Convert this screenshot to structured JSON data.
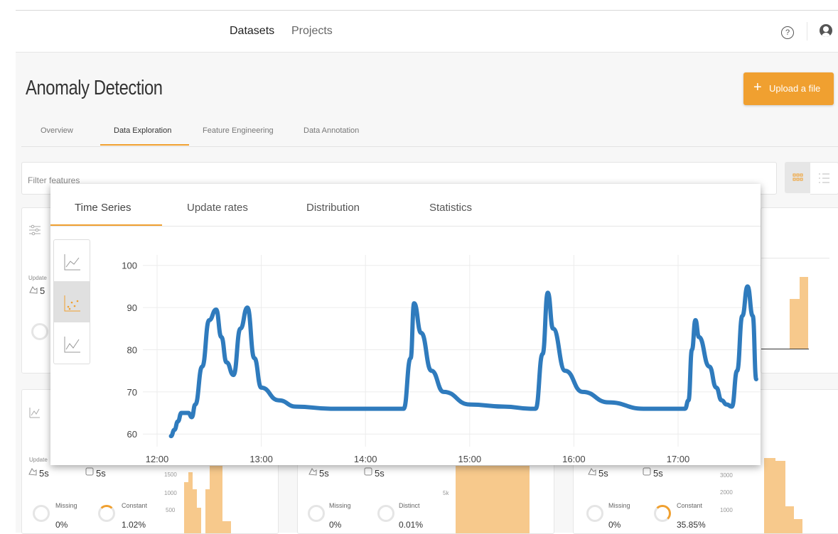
{
  "nav": {
    "datasets": "Datasets",
    "projects": "Projects",
    "help_icon": "?"
  },
  "page": {
    "title": "Anomaly Detection",
    "upload_label": "Upload a file",
    "upload_plus": "+"
  },
  "tabs": [
    "Overview",
    "Data Exploration",
    "Feature Engineering",
    "Data Annotation"
  ],
  "filter": {
    "placeholder": "Filter features"
  },
  "popup": {
    "tabs": [
      "Time Series",
      "Update rates",
      "Distribution",
      "Statistics"
    ]
  },
  "cards_top": {
    "update_label": "Update",
    "update_value": "5"
  },
  "cards_bottom": [
    {
      "update_label": "Update",
      "rate1": "5s",
      "rate2": "5s",
      "stat1_label": "Missing",
      "stat1_value": "0%",
      "stat2_label": "Constant",
      "stat2_value": "1.02%",
      "ticks": [
        "1500",
        "1000",
        "500"
      ]
    },
    {
      "rate1": "5s",
      "rate2": "5s",
      "stat1_label": "Missing",
      "stat1_value": "0%",
      "stat2_label": "Distinct",
      "stat2_value": "0.01%",
      "ticks": [
        "5k"
      ]
    },
    {
      "rate1": "5s",
      "rate2": "5s",
      "stat1_label": "Missing",
      "stat1_value": "0%",
      "stat2_label": "Constant",
      "stat2_value": "35.85%",
      "ticks": [
        "3000",
        "2000",
        "1000"
      ]
    }
  ],
  "colors": {
    "accent": "#f0a030",
    "series": "#2f7bbd",
    "hist": "#f7c98c"
  },
  "chart_data": {
    "type": "line",
    "title": "",
    "xlabel": "",
    "ylabel": "",
    "x_ticks": [
      "12:00",
      "13:00",
      "14:00",
      "15:00",
      "16:00",
      "17:00"
    ],
    "y_ticks": [
      60,
      70,
      80,
      90,
      100
    ],
    "ylim": [
      57,
      105
    ],
    "xlim": [
      "12:00",
      "17:45"
    ],
    "grid": true,
    "series": [
      {
        "name": "",
        "x": [
          "12:08",
          "12:10",
          "12:12",
          "12:14",
          "12:16",
          "12:18",
          "12:20",
          "12:22",
          "12:26",
          "12:30",
          "12:34",
          "12:37",
          "12:40",
          "12:44",
          "12:48",
          "12:52",
          "12:56",
          "13:00",
          "13:10",
          "13:20",
          "13:40",
          "14:00",
          "14:10",
          "14:18",
          "14:22",
          "14:26",
          "14:28",
          "14:32",
          "14:38",
          "14:45",
          "15:00",
          "15:20",
          "15:35",
          "15:38",
          "15:42",
          "15:45",
          "15:48",
          "15:55",
          "16:05",
          "16:20",
          "16:40",
          "17:00",
          "17:04",
          "17:06",
          "17:08",
          "17:10",
          "17:12",
          "17:18",
          "17:22",
          "17:25",
          "17:28",
          "17:31",
          "17:34",
          "17:37",
          "17:40",
          "17:43",
          "17:45"
        ],
        "y": [
          59.5,
          61,
          63,
          65,
          65,
          65,
          64,
          67,
          76,
          87,
          89.5,
          83,
          77,
          74,
          85,
          90,
          78,
          71,
          68,
          66.5,
          66,
          66,
          66,
          66,
          66,
          78,
          91,
          84,
          75,
          70,
          67,
          66.5,
          66,
          66,
          79,
          93.5,
          85,
          75,
          70,
          67.5,
          66,
          66,
          66,
          68,
          80,
          87,
          83,
          76,
          71,
          68,
          67,
          66.5,
          75,
          88,
          95,
          88,
          73
        ]
      }
    ]
  }
}
